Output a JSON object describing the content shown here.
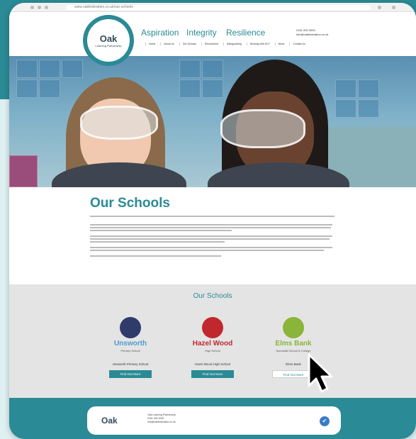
{
  "browser": {
    "url": "www.oakfederation.co.uk/our-schools"
  },
  "header": {
    "logo_word": "Oak",
    "logo_sub": "Learning Partnership",
    "tagline": [
      "Aspiration",
      "Integrity",
      "Resilience"
    ],
    "contact_phone": "0161 000 0000",
    "contact_email": "info@oakfederation.co.uk",
    "nav_items": [
      "Home",
      "About Us",
      "Our Schools",
      "Recruitment",
      "Safeguarding",
      "Working with OLP",
      "News",
      "Contact Us"
    ]
  },
  "main": {
    "title": "Our Schools"
  },
  "schools": {
    "heading": "Our Schools",
    "list": [
      {
        "name": "Unsworth",
        "sub": "Primary School",
        "caption": "Unsworth Primary School",
        "button": "Find Out More",
        "color": "#4a9bd0"
      },
      {
        "name": "Hazel Wood",
        "sub": "High School",
        "caption": "Hazel Wood High School",
        "button": "Find Out More",
        "color": "#c0282e"
      },
      {
        "name": "Elms Bank",
        "sub": "Specialist School & College",
        "caption": "Elms Bank",
        "button": "Find Out More",
        "color": "#8ab43a"
      }
    ]
  },
  "footer": {
    "logo_word": "Oak",
    "address": "Oak Learning Partnership",
    "phone": "0161 000 0000",
    "email": "info@oakfederation.co.uk"
  }
}
